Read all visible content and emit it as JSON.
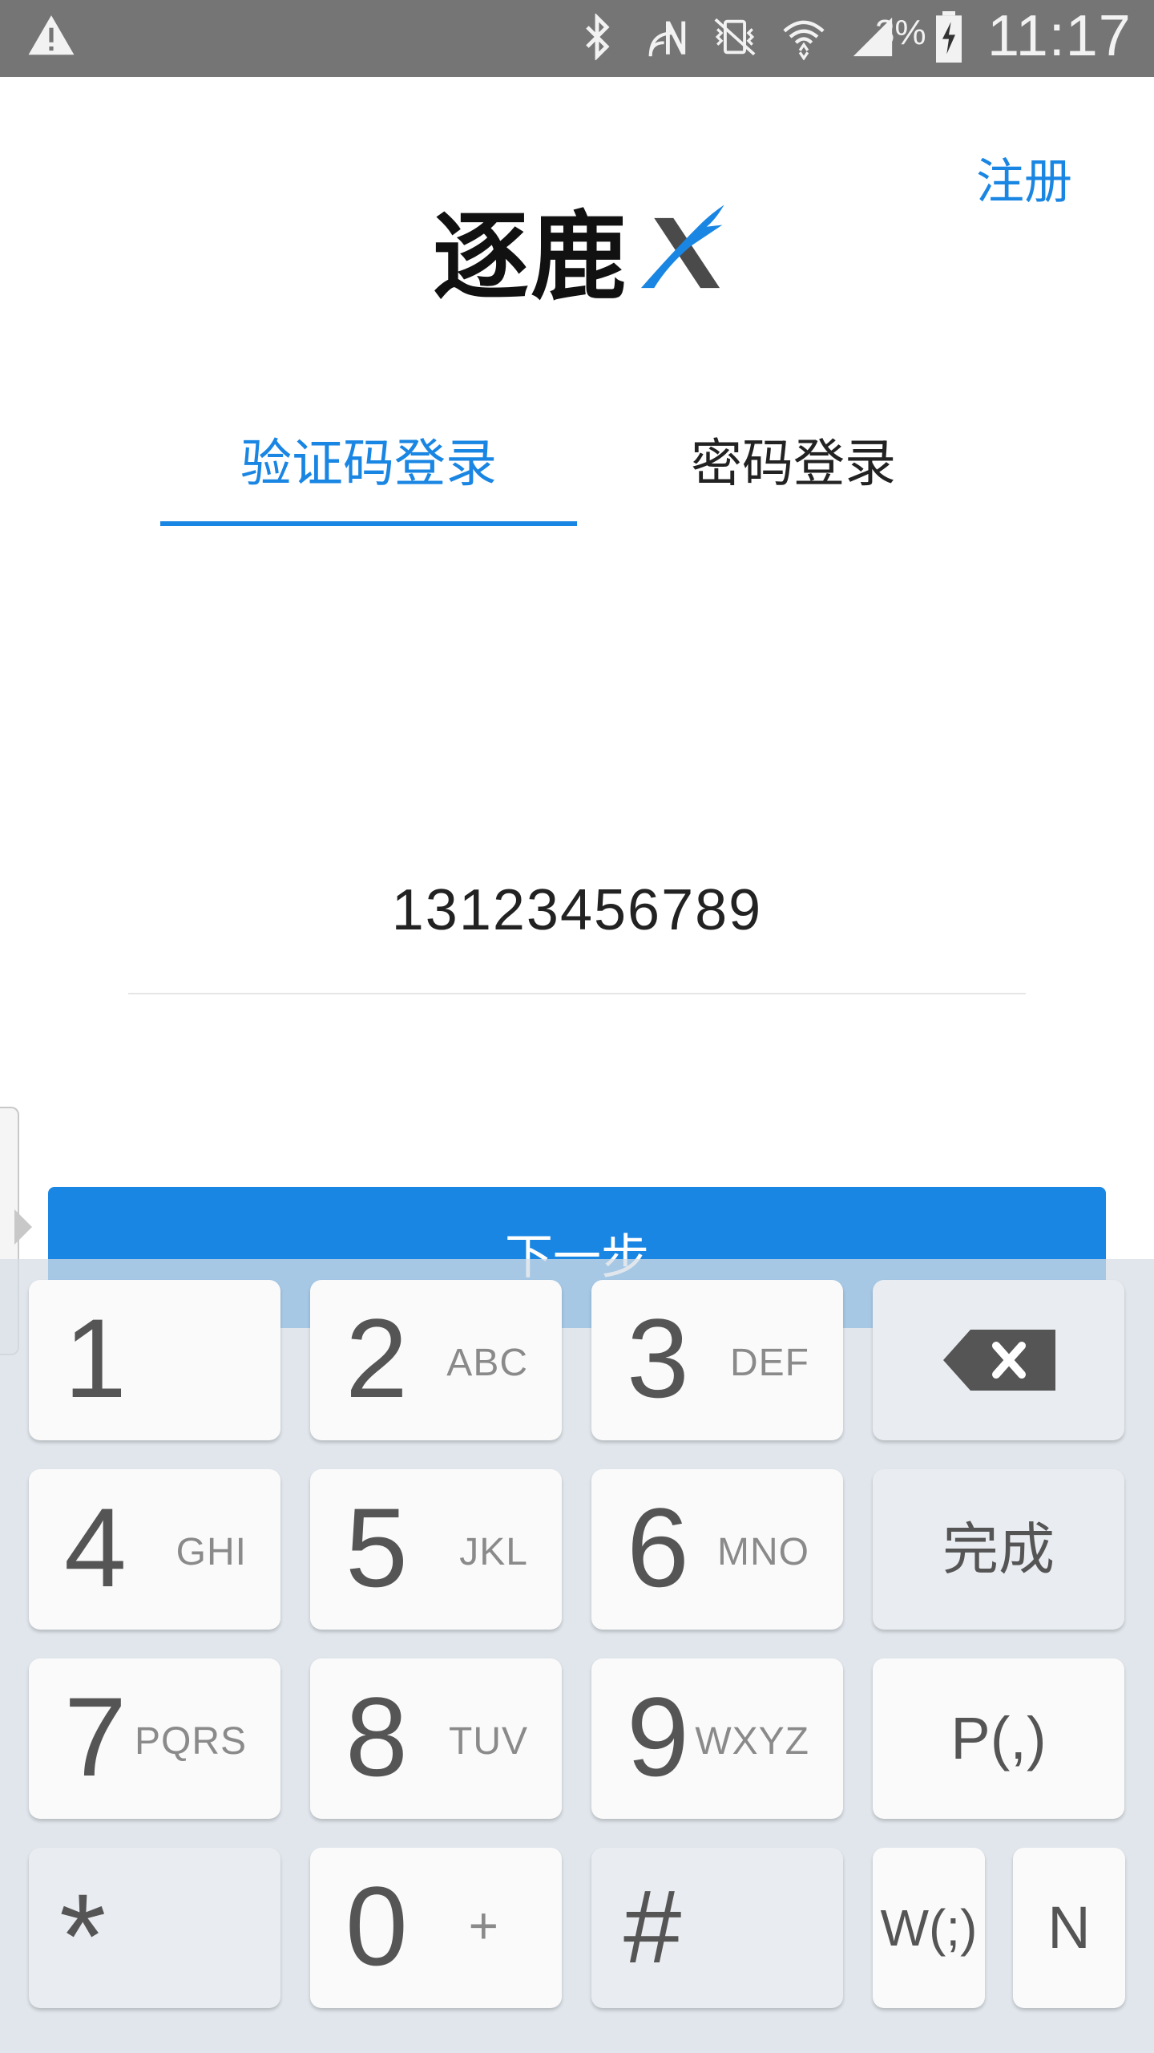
{
  "status_bar": {
    "battery_percent": "3%",
    "time": "11:17",
    "icons": [
      "warning-icon",
      "bluetooth-icon",
      "nfc-icon",
      "vibrate-icon",
      "wifi-icon",
      "signal-icon",
      "battery-charging-icon"
    ]
  },
  "header": {
    "register_label": "注册",
    "logo_text": "逐鹿"
  },
  "tabs": [
    {
      "label": "验证码登录",
      "active": true
    },
    {
      "label": "密码登录",
      "active": false
    }
  ],
  "phone": {
    "value": "13123456789"
  },
  "next_button": {
    "label": "下一步"
  },
  "keyboard": {
    "keys": [
      {
        "num": "1",
        "sub": ""
      },
      {
        "num": "2",
        "sub": "ABC"
      },
      {
        "num": "3",
        "sub": "DEF"
      },
      {
        "num": "4",
        "sub": "GHI"
      },
      {
        "num": "5",
        "sub": "JKL"
      },
      {
        "num": "6",
        "sub": "MNO"
      },
      {
        "num": "7",
        "sub": "PQRS"
      },
      {
        "num": "8",
        "sub": "TUV"
      },
      {
        "num": "9",
        "sub": "WXYZ"
      },
      {
        "num": "0",
        "sub": "+"
      }
    ],
    "done_label": "完成",
    "pause_label": "P(,)",
    "star_label": "*",
    "hash_label": "#",
    "wait_label": "W(;)",
    "n_label": "N"
  },
  "colors": {
    "accent": "#1a86e3",
    "status_bar": "#757575"
  }
}
